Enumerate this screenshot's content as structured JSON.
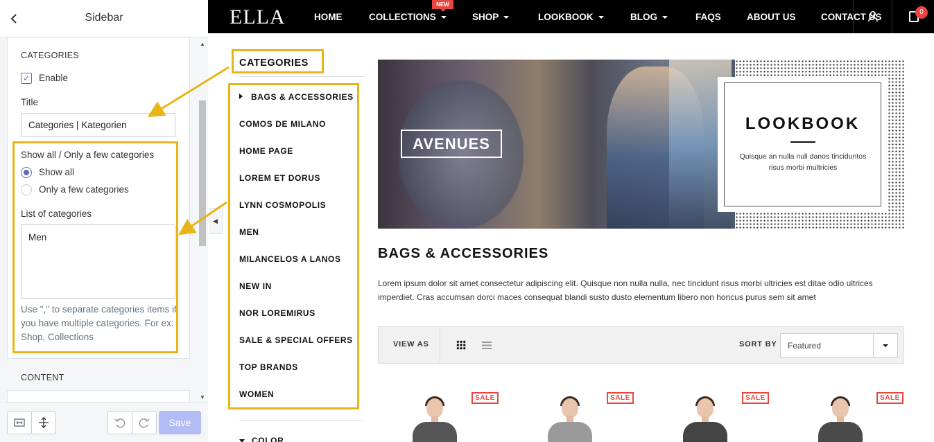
{
  "editor": {
    "header": {
      "back_icon": "chevron-left-icon",
      "title": "Sidebar"
    },
    "categories_section": {
      "heading": "CATEGORIES",
      "enable_label": "Enable",
      "enable_checked": true,
      "title_label": "Title",
      "title_value": "Categories | Kategorien",
      "show_label": "Show all / Only a few categories",
      "radio_options": [
        {
          "label": "Show all",
          "selected": true
        },
        {
          "label": "Only a few categories",
          "selected": false
        }
      ],
      "list_label": "List of categories",
      "list_value": "Men",
      "help_text": "Use \",\" to separate categories items if you have multiple categories. For ex: Shop, Collections"
    },
    "content_section": {
      "heading": "CONTENT"
    },
    "footer": {
      "save_label": "Save",
      "undo_icon": "undo-icon",
      "redo_icon": "redo-icon"
    }
  },
  "store": {
    "logo": "ELLA",
    "nav": [
      {
        "label": "HOME",
        "dropdown": false
      },
      {
        "label": "COLLECTIONS",
        "dropdown": true,
        "badge": "NEW"
      },
      {
        "label": "SHOP",
        "dropdown": true
      },
      {
        "label": "LOOKBOOK",
        "dropdown": true
      },
      {
        "label": "BLOG",
        "dropdown": true
      },
      {
        "label": "FAQS",
        "dropdown": false
      },
      {
        "label": "ABOUT US",
        "dropdown": false
      },
      {
        "label": "CONTACT US",
        "dropdown": false
      }
    ],
    "cart_count": "0",
    "sidebar": {
      "title": "CATEGORIES",
      "categories": [
        "BAGS & ACCESSORIES",
        "COMOS DE MILANO",
        "HOME PAGE",
        "LOREM ET DORUS",
        "LYNN COSMOPOLIS",
        "MEN",
        "MILANCELOS A LANOS",
        "NEW IN",
        "NOR LOREMIRUS",
        "SALE & SPECIAL OFFERS",
        "TOP BRANDS",
        "WOMEN"
      ],
      "next_filter": "COLOR"
    },
    "banner": {
      "label": "AVENUES"
    },
    "lookbook": {
      "title": "LOOKBOOK",
      "text": "Quisque an nulla null danos tinciduntos risus morbi multricies"
    },
    "collection": {
      "title": "BAGS & ACCESSORIES",
      "description": "Lorem ipsum dolor sit amet consectetur adipiscing elit. Quisque non nulla nulla, nec tincidunt risus morbi ultricies est ditae odio ultrices imperdiet. Cras accumsan dorci maces consequat blandi susto dusto elementum libero non honcus purus sem sit amet"
    },
    "toolbar": {
      "view_as": "VIEW AS",
      "sort_by": "SORT BY",
      "sort_value": "Featured"
    },
    "products": [
      {
        "badge": "SALE"
      },
      {
        "badge": "SALE"
      },
      {
        "badge": "SALE"
      },
      {
        "badge": "SALE"
      }
    ]
  },
  "colors": {
    "accent": "#5c6ac4",
    "highlight": "#e8b418",
    "sale": "#e9463f",
    "topbar": "#000000"
  }
}
